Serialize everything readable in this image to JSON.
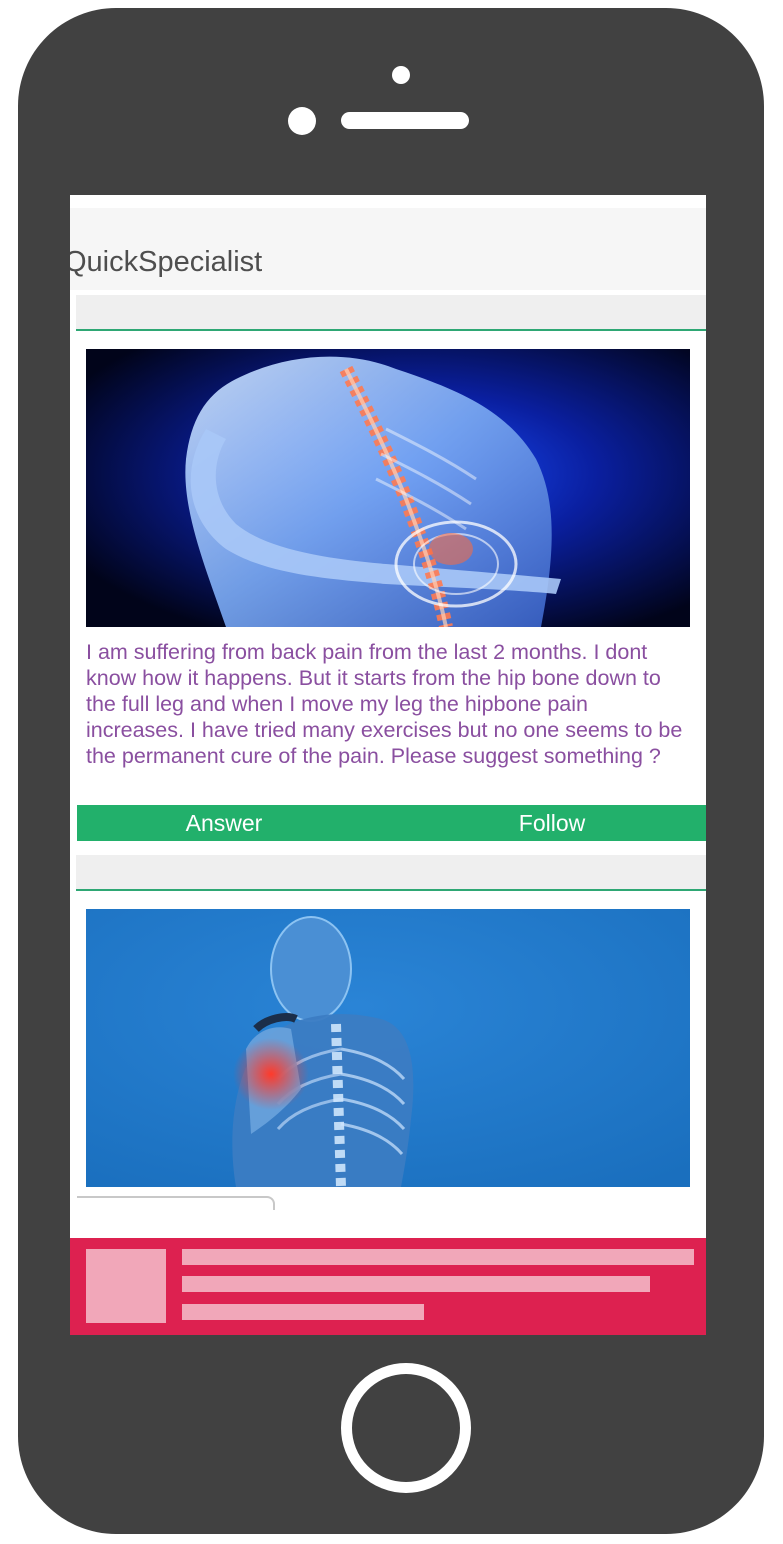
{
  "app": {
    "title": "QuickSpecialist"
  },
  "colors": {
    "device_body": "#414141",
    "divider_green": "#2ea774",
    "question_text": "#8a4fa0",
    "action_bar": "#22b06b",
    "ad_banner": "#dd2150",
    "ad_placeholder": "#f1a7b9"
  },
  "feed": {
    "posts": [
      {
        "image_icon": "back-pain-spine-illustration",
        "question": "I am suffering from back pain from the last 2 months. I dont know how it happens. But it starts from the hip bone down to the full leg and when I move my leg the hipbone pain increases. I have tried many exercises but no one seems to be the permanent cure of the pain. Please suggest something ?",
        "answer_label": "Answer",
        "follow_label": "Follow"
      },
      {
        "image_icon": "shoulder-pain-skeleton-illustration"
      }
    ]
  },
  "device": {
    "home_button_icon": "home-button-ring"
  }
}
